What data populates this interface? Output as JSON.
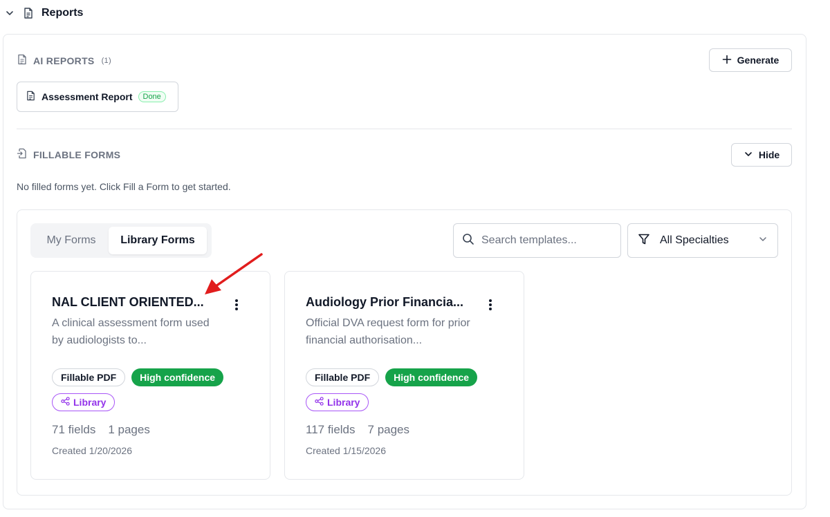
{
  "section": {
    "title": "Reports"
  },
  "ai_reports": {
    "title": "AI REPORTS",
    "count": "(1)",
    "generate_label": "Generate",
    "report": {
      "name": "Assessment Report",
      "status": "Done"
    }
  },
  "fillable_forms": {
    "title": "FILLABLE FORMS",
    "hide_label": "Hide",
    "empty_text": "No filled forms yet. Click Fill a Form to get started."
  },
  "library": {
    "tabs": [
      "My Forms",
      "Library Forms"
    ],
    "active_tab": "Library Forms",
    "search": {
      "placeholder": "Search templates..."
    },
    "filter": {
      "selected": "All Specialties"
    },
    "cards": [
      {
        "title": "NAL CLIENT ORIENTED...",
        "description": "A clinical assessment form used by audiologists to...",
        "type_badge": "Fillable PDF",
        "confidence_badge": "High confidence",
        "library_badge": "Library",
        "fields": "71 fields",
        "pages": "1 pages",
        "created": "Created 1/20/2026"
      },
      {
        "title": "Audiology Prior Financia...",
        "description": "Official DVA request form for prior financial authorisation...",
        "type_badge": "Fillable PDF",
        "confidence_badge": "High confidence",
        "library_badge": "Library",
        "fields": "117 fields",
        "pages": "7 pages",
        "created": "Created 1/15/2026"
      }
    ]
  },
  "colors": {
    "success": "#16a34a",
    "library": "#9333ea",
    "annotation_arrow": "#e11d1d"
  },
  "icons": [
    "chevron-down-icon",
    "document-icon",
    "plus-icon",
    "file-input-icon",
    "search-icon",
    "filter-icon",
    "kebab-menu-icon",
    "share-nodes-icon"
  ]
}
